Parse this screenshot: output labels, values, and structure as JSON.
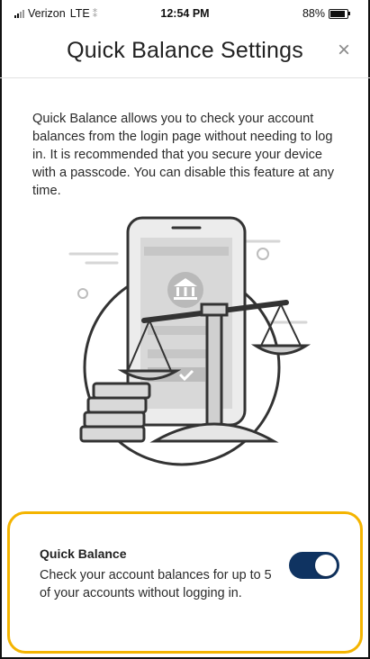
{
  "status_bar": {
    "carrier": "Verizon",
    "network": "LTE",
    "time": "12:54 PM",
    "battery_percent": "88%",
    "battery_level": 0.88
  },
  "header": {
    "title": "Quick Balance Settings",
    "close_icon": "×"
  },
  "intro_text": "Quick Balance allows you to check your account balances from the login page without needing to log in. It is recommended that you secure your device with a passcode. You can disable this feature at any time.",
  "illustration": {
    "icon": "bank-balance-phone-illustration",
    "colors": {
      "stroke": "#333333",
      "fill": "#cfcfcf",
      "light": "#ececec"
    }
  },
  "quick_balance": {
    "title": "Quick Balance",
    "description": "Check your account balances for up to 5 of your accounts without logging in.",
    "toggle_on": true,
    "highlight_color": "#f4b400",
    "toggle_color": "#0f3361"
  }
}
